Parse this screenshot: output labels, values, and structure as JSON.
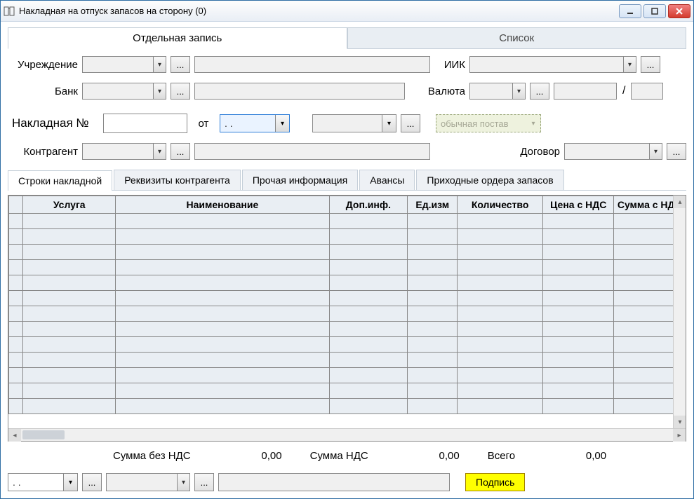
{
  "window": {
    "title": "Накладная на отпуск запасов на сторону (0)"
  },
  "top_tabs": {
    "single": "Отдельная запись",
    "list": "Список"
  },
  "form": {
    "institution_label": "Учреждение",
    "bank_label": "Банк",
    "iik_label": "ИИК",
    "currency_label": "Валюта",
    "invoice_no_label": "Накладная №",
    "from_label": "от",
    "date_placeholder": "  .  .",
    "delivery_type": "обычная постав",
    "counterparty_label": "Контрагент",
    "contract_label": "Договор"
  },
  "sub_tabs": {
    "lines": "Строки накладной",
    "requisites": "Реквизиты контрагента",
    "other": "Прочая информация",
    "advances": "Авансы",
    "receipts": "Приходные ордера запасов"
  },
  "grid": {
    "columns": [
      "Услуга",
      "Наименование",
      "Доп.инф.",
      "Ед.изм",
      "Количество",
      "Цена с НДС",
      "Сумма с НДС"
    ]
  },
  "totals": {
    "without_vat_label": "Сумма без НДС",
    "without_vat_value": "0,00",
    "vat_label": "Сумма НДС",
    "vat_value": "0,00",
    "total_label": "Всего",
    "total_value": "0,00"
  },
  "footer": {
    "date_placeholder": "  .  .",
    "signature_button": "Подпись"
  }
}
